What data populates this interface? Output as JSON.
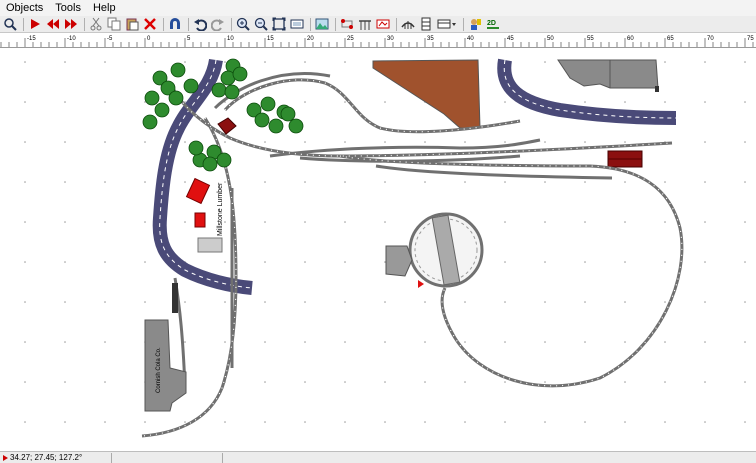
{
  "menu": [
    "Objects",
    "Tools",
    "Help"
  ],
  "toolbar_icons": [
    "zoom-select",
    "run",
    "rewind",
    "fast-forward",
    "cut",
    "copy",
    "paste",
    "delete",
    "magnet",
    "undo",
    "redo",
    "zoom-in",
    "zoom-out",
    "zoom-fit",
    "zoom-page",
    "landscape",
    "track-connect",
    "bridge",
    "terrain",
    "trestle",
    "car-dropdown",
    "driver",
    "view-2d"
  ],
  "ruler": {
    "labels": [
      "-15",
      "-10",
      "-5",
      "0",
      "5",
      "10",
      "15",
      "20",
      "25",
      "30",
      "35",
      "40",
      "45",
      "50",
      "55",
      "60",
      "65",
      "70",
      "75"
    ]
  },
  "canvas": {
    "label_lumber": "Millstone Lumber",
    "label_cola": "Cornish Cola Co."
  },
  "status": {
    "coords": "34.27; 27.45; 127.2°"
  },
  "colors": {
    "road": "#4a4a78",
    "road_stripe": "#ffffff",
    "tree": "#2e8b2e",
    "building_brown": "#a0522d",
    "building_gray": "#8a8a8a",
    "red_structure": "#e01010",
    "dark_red": "#8b1010",
    "track": "#707070"
  }
}
